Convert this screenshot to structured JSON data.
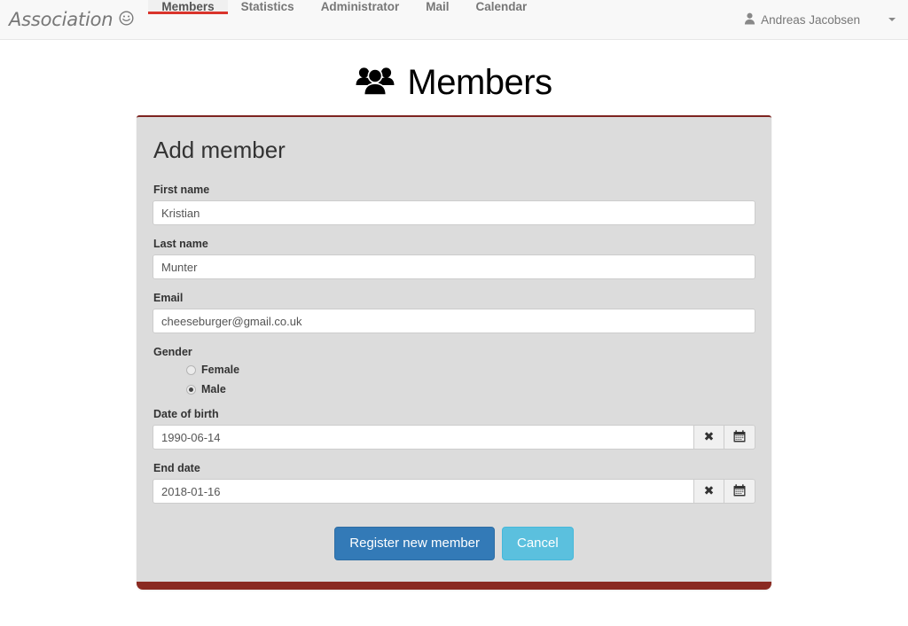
{
  "navbar": {
    "brand": "Association",
    "brand_icon": "smiley-face-icon",
    "tabs": [
      {
        "label": "Members",
        "active": true
      },
      {
        "label": "Statistics",
        "active": false
      },
      {
        "label": "Administrator",
        "active": false
      },
      {
        "label": "Mail",
        "active": false
      },
      {
        "label": "Calendar",
        "active": false
      }
    ],
    "user": {
      "name": "Andreas Jacobsen",
      "icon": "user-icon",
      "caret": "caret-down-icon"
    },
    "colors": {
      "background": "#f8f8f8",
      "active_underline": "#d9342b",
      "text": "#777777"
    }
  },
  "page": {
    "title": "Members",
    "title_icon": "users-group-icon"
  },
  "panel": {
    "title": "Add member",
    "accent_color": "#8a2a22",
    "background": "#dcdcdc",
    "fields": [
      {
        "label": "First name",
        "value": "Kristian",
        "placeholder": "First name",
        "name": "first-name"
      },
      {
        "label": "Last name",
        "value": "Munter",
        "placeholder": "Last name",
        "name": "last-name"
      },
      {
        "label": "Email",
        "value": "cheeseburger@gmail.co.uk",
        "placeholder": "Email",
        "name": "email"
      }
    ],
    "gender": {
      "label": "Gender",
      "options": [
        {
          "label": "Female",
          "checked": false
        },
        {
          "label": "Male",
          "checked": true
        }
      ]
    },
    "dates": [
      {
        "label": "Date of birth",
        "value": "1990-06-14",
        "placeholder": "Date of birth",
        "clear_icon": "close-x-icon",
        "calendar_icon": "calendar-icon",
        "name": "date-of-birth"
      },
      {
        "label": "End date",
        "value": "2018-01-16",
        "placeholder": "End date",
        "clear_icon": "close-x-icon",
        "calendar_icon": "calendar-icon",
        "name": "end-date"
      }
    ],
    "actions": {
      "submit_label": "Register new member",
      "submit_color": "#337ab7",
      "cancel_label": "Cancel",
      "cancel_color": "#5bc0de"
    }
  }
}
